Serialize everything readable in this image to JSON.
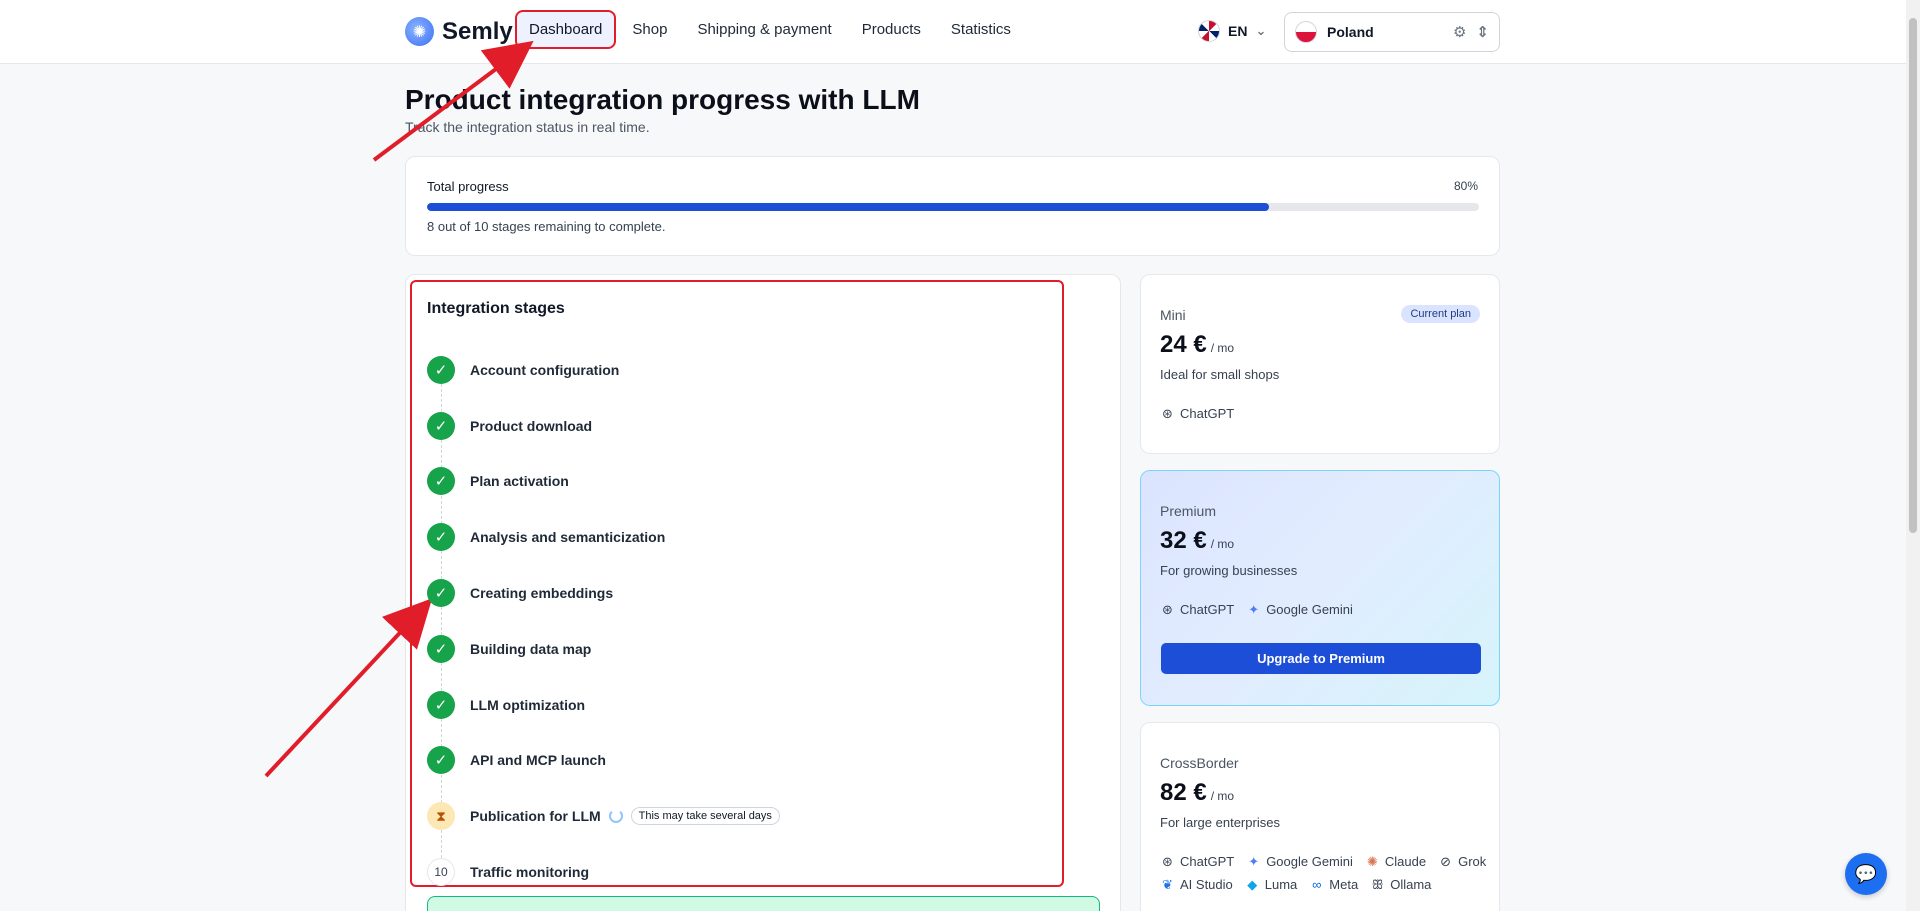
{
  "brand": {
    "name": "Semly"
  },
  "nav": {
    "items": [
      {
        "label": "Dashboard",
        "active": true
      },
      {
        "label": "Shop"
      },
      {
        "label": "Shipping & payment"
      },
      {
        "label": "Products"
      },
      {
        "label": "Statistics"
      }
    ]
  },
  "language": {
    "code": "EN",
    "flag": "uk-flag-icon"
  },
  "country": {
    "name": "Poland",
    "flag": "poland-flag-icon"
  },
  "page": {
    "title": "Product integration progress with LLM",
    "subtitle": "Track the integration status in real time."
  },
  "progress": {
    "label": "Total progress",
    "percent_label": "80%",
    "value": 0.8,
    "note": "8 out of 10 stages remaining to complete."
  },
  "stages": {
    "title": "Integration stages",
    "items": [
      {
        "label": "Account configuration",
        "status": "done"
      },
      {
        "label": "Product download",
        "status": "done"
      },
      {
        "label": "Plan activation",
        "status": "done"
      },
      {
        "label": "Analysis and semanticization",
        "status": "done"
      },
      {
        "label": "Creating embeddings",
        "status": "done"
      },
      {
        "label": "Building data map",
        "status": "done"
      },
      {
        "label": "LLM optimization",
        "status": "done"
      },
      {
        "label": "API and MCP launch",
        "status": "done"
      },
      {
        "label": "Publication for LLM",
        "status": "pending",
        "badge": "This may take several days"
      },
      {
        "label": "Traffic monitoring",
        "status": "todo",
        "number": "10"
      }
    ]
  },
  "plans": {
    "mini": {
      "name": "Mini",
      "price": "24 €",
      "period": "/ mo",
      "description": "Ideal for small shops",
      "tag": "Current plan",
      "models": [
        "ChatGPT"
      ]
    },
    "premium": {
      "name": "Premium",
      "price": "32 €",
      "period": "/ mo",
      "description": "For growing businesses",
      "models": [
        "ChatGPT",
        "Google Gemini"
      ],
      "button": "Upgrade to Premium"
    },
    "crossborder": {
      "name": "CrossBorder",
      "price": "82 €",
      "period": "/ mo",
      "description": "For large enterprises",
      "models": [
        "ChatGPT",
        "Google Gemini",
        "Claude",
        "Grok",
        "AI Studio",
        "Luma",
        "Meta",
        "Ollama"
      ]
    }
  },
  "colors": {
    "accent": "#1d4ed8",
    "done": "#16a34a",
    "annotation": "#e11d2a"
  }
}
